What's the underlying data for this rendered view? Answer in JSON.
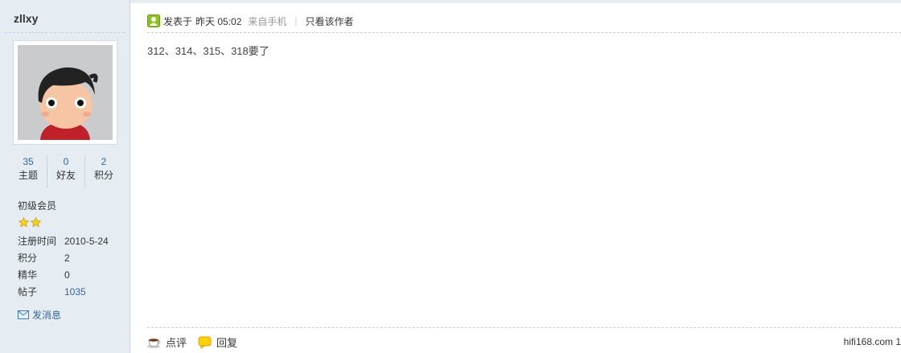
{
  "user": {
    "name": "zllxy",
    "stats": [
      {
        "value": "35",
        "label": "主题"
      },
      {
        "value": "0",
        "label": "好友"
      },
      {
        "value": "2",
        "label": "积分"
      }
    ],
    "group": "初级会员",
    "star_count": 2,
    "profile": [
      {
        "key": "注册时间",
        "value": "2010-5-24"
      },
      {
        "key": "积分",
        "value": "2"
      },
      {
        "key": "精华",
        "value": "0"
      },
      {
        "key": "帖子",
        "value": "1035"
      }
    ],
    "send_message": "发消息"
  },
  "post": {
    "posted_label": "发表于",
    "time": "昨天 05:02",
    "via": "来自手机",
    "separator": "|",
    "author_only": "只看该作者",
    "content": "312、314、315、318要了"
  },
  "actions": {
    "comment": "点评",
    "reply": "回复"
  },
  "footer": {
    "site": "hifi168.com 1"
  },
  "colors": {
    "sidebar_bg": "#e5edf2",
    "link": "#336699"
  }
}
